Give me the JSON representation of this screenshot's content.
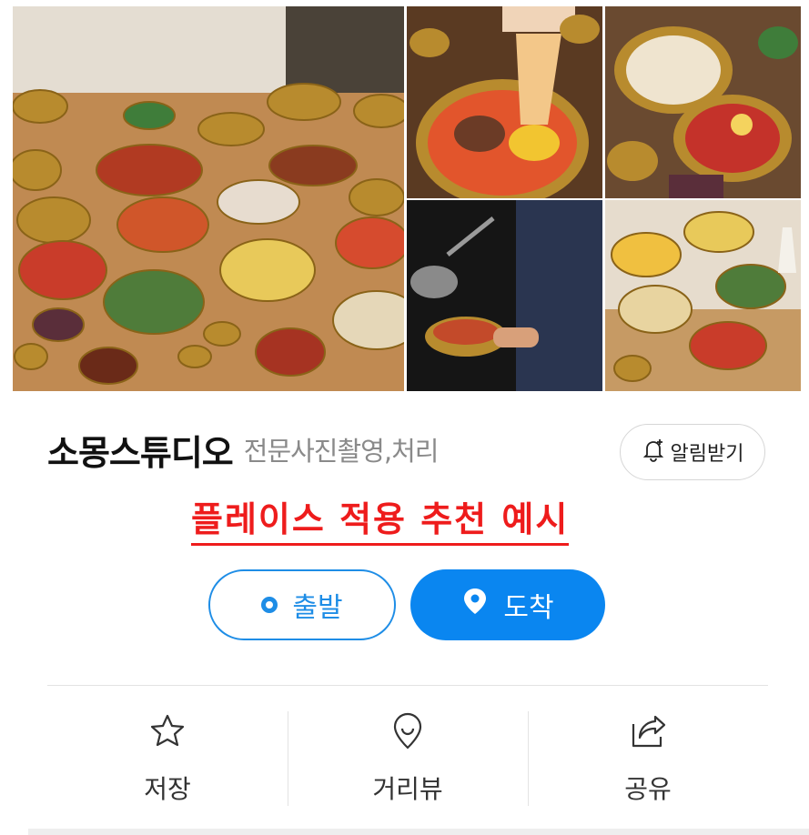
{
  "place": {
    "name": "소몽스튜디오",
    "category": "전문사진촬영,처리"
  },
  "notify": {
    "label": "알림받기",
    "icon": "bell-plus-icon"
  },
  "promo": {
    "text": "플레이스 적용 추천 예시",
    "color": "#ee1c1c"
  },
  "route": {
    "depart_label": "출발",
    "arrive_label": "도착",
    "accent": "#0a86f0"
  },
  "actions": [
    {
      "label": "저장",
      "icon": "star-icon"
    },
    {
      "label": "거리뷰",
      "icon": "map-pin-icon"
    },
    {
      "label": "공유",
      "icon": "share-icon"
    }
  ],
  "gallery": {
    "photos": [
      "korean-table-spread-photo",
      "noodle-lift-photo",
      "dumplings-and-naengmyeon-photo",
      "chef-pouring-broth-photo",
      "brass-bowls-arrangement-photo"
    ]
  }
}
